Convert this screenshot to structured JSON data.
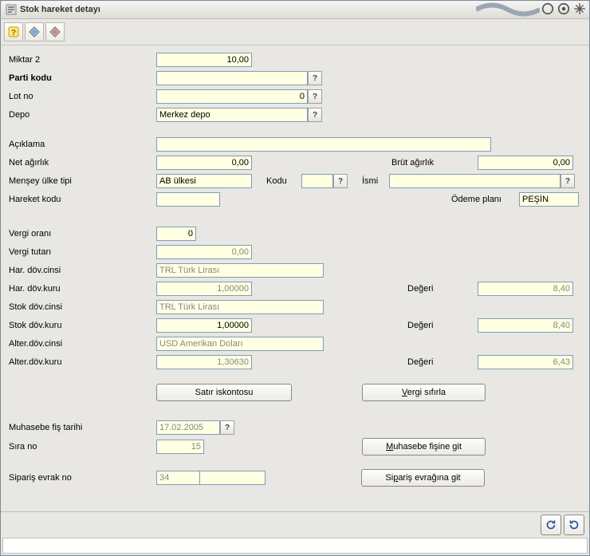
{
  "window": {
    "title": "Stok hareket detayı"
  },
  "toolbar": {
    "items": [
      {
        "name": "help-icon"
      },
      {
        "name": "diamond-icon"
      },
      {
        "name": "diamond-alt-icon"
      }
    ]
  },
  "labels": {
    "miktar2": "Miktar 2",
    "partiKodu": "Parti kodu",
    "lotNo": "Lot no",
    "depo": "Depo",
    "aciklama": "Açıklama",
    "netAgirlik": "Net ağırlık",
    "brutAgirlik": "Brüt ağırlık",
    "menseyUlkeTipi": "Menşey ülke tipi",
    "kodu": "Kodu",
    "ismi": "İsmi",
    "hareketKodu": "Hareket kodu",
    "odemePlani": "Ödeme planı",
    "vergiOrani": "Vergi oranı",
    "vergiTutari": "Vergi tutarı",
    "harDovCinsi": "Har. döv.cinsi",
    "harDovKuru": "Har. döv.kuru",
    "stokDovCinsi": "Stok döv.cinsi",
    "stokDovKuru": "Stok döv.kuru",
    "alterDovCinsi": "Alter.döv.cinsi",
    "alterDovKuru": "Alter.döv.kuru",
    "degeri": "Değeri",
    "muhasebeFisTarihi": "Muhasebe fiş tarihi",
    "siraNo": "Sıra no",
    "siparisEvrakNo": "Sipariş evrak no"
  },
  "values": {
    "miktar2": "10,00",
    "partiKodu": "",
    "lotNo": "0",
    "depo": "Merkez depo",
    "aciklama": "",
    "netAgirlik": "0,00",
    "brutAgirlik": "0,00",
    "menseyUlkeTipi": "AB ülkesi",
    "kodu": "",
    "ismi": "",
    "hareketKodu": "",
    "odemePlani": "PEŞİN",
    "vergiOrani": "0",
    "vergiTutari": "0,00",
    "harDovCinsi": "TRL Türk Lirası",
    "harDovKuru": "1,00000",
    "harDegeri": "8,40",
    "stokDovCinsi": "TRL Türk Lirası",
    "stokDovKuru": "1,00000",
    "stokDegeri": "8,40",
    "alterDovCinsi": "USD Amerikan Doları",
    "alterDovKuru": "1,30630",
    "alterDegeri": "6,43",
    "muhasebeFisTarihi": "17.02.2005",
    "siraNo": "15",
    "siparisEvrakNoPrefix": "34",
    "siparisEvrakNo": ""
  },
  "buttons": {
    "satirIskontosu": "Satır iskontosu",
    "vergiSifirla_pre": "",
    "vergiSifirla_und": "V",
    "vergiSifirla_post": "ergi sıfırla",
    "muhasebeFisineGit_pre": "",
    "muhasebeFisineGit_und": "M",
    "muhasebeFisineGit_post": "uhasebe fişine git",
    "siparisEvraginaGit_pre": "Si",
    "siparisEvraginaGit_und": "p",
    "siparisEvraginaGit_post": "ariş evrağına git",
    "q": "?"
  }
}
